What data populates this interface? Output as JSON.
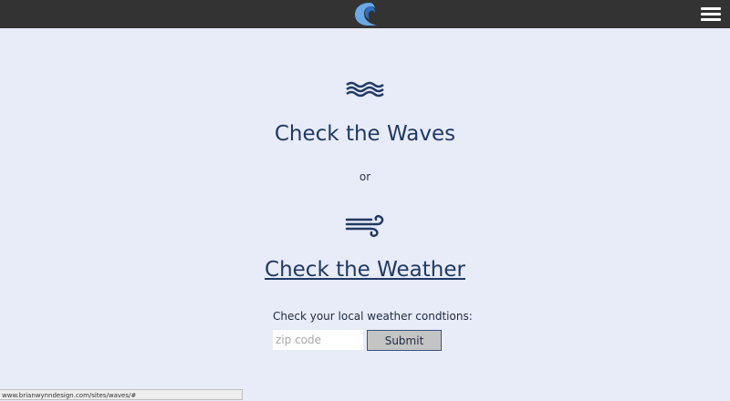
{
  "header": {
    "logo_icon": "wave-crescent-logo-icon",
    "menu_icon": "hamburger-menu-icon",
    "background_color": "#333333"
  },
  "main": {
    "waves_icon": "waves-icon",
    "waves_link": "Check the Waves",
    "or_text": "or",
    "wind_icon": "wind-icon",
    "weather_link": "Check the Weather",
    "zip_label": "Check your local weather condtions:",
    "zip_placeholder": "zip code",
    "zip_value": "",
    "submit_label": "Submit",
    "text_color": "#1f3a63",
    "background_color": "#e8ebf8"
  },
  "status_bar": {
    "url": "www.brianwynndesign.com/sites/waves/#"
  }
}
